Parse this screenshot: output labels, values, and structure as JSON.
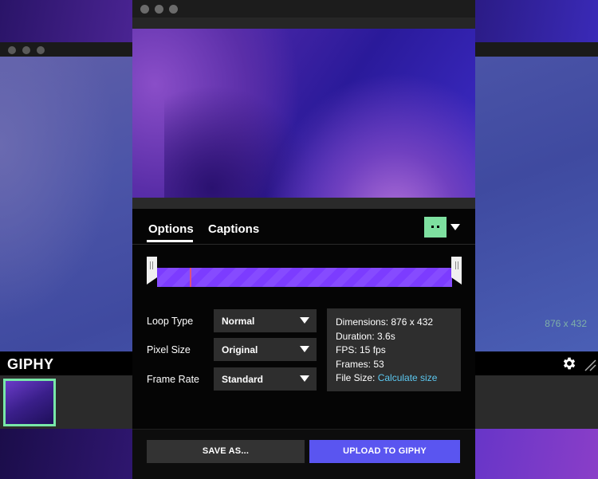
{
  "background_window": {
    "app_name": "GIPHY",
    "dimensions_label": "876 x 432",
    "icons": [
      "gear-icon",
      "resize-grip-icon"
    ]
  },
  "tabs": [
    {
      "label": "Options",
      "active": true
    },
    {
      "label": "Captions",
      "active": false
    }
  ],
  "trim": {
    "playhead_fraction": 0.11
  },
  "options": {
    "loop_type": {
      "label": "Loop Type",
      "value": "Normal"
    },
    "pixel_size": {
      "label": "Pixel Size",
      "value": "Original"
    },
    "frame_rate": {
      "label": "Frame Rate",
      "value": "Standard"
    }
  },
  "info": {
    "dimensions": "Dimensions: 876 x 432",
    "duration": "Duration: 3.6s",
    "fps": "FPS: 15 fps",
    "frames": "Frames: 53",
    "file_size_label": "File Size: ",
    "file_size_link": "Calculate size"
  },
  "buttons": {
    "save_as": "SAVE AS...",
    "upload": "UPLOAD TO GIPHY"
  },
  "colors": {
    "accent_purple": "#7c3cff",
    "upload_button": "#5a55f0",
    "avatar_green": "#7ee0a0",
    "link_blue": "#5cc8f0"
  }
}
